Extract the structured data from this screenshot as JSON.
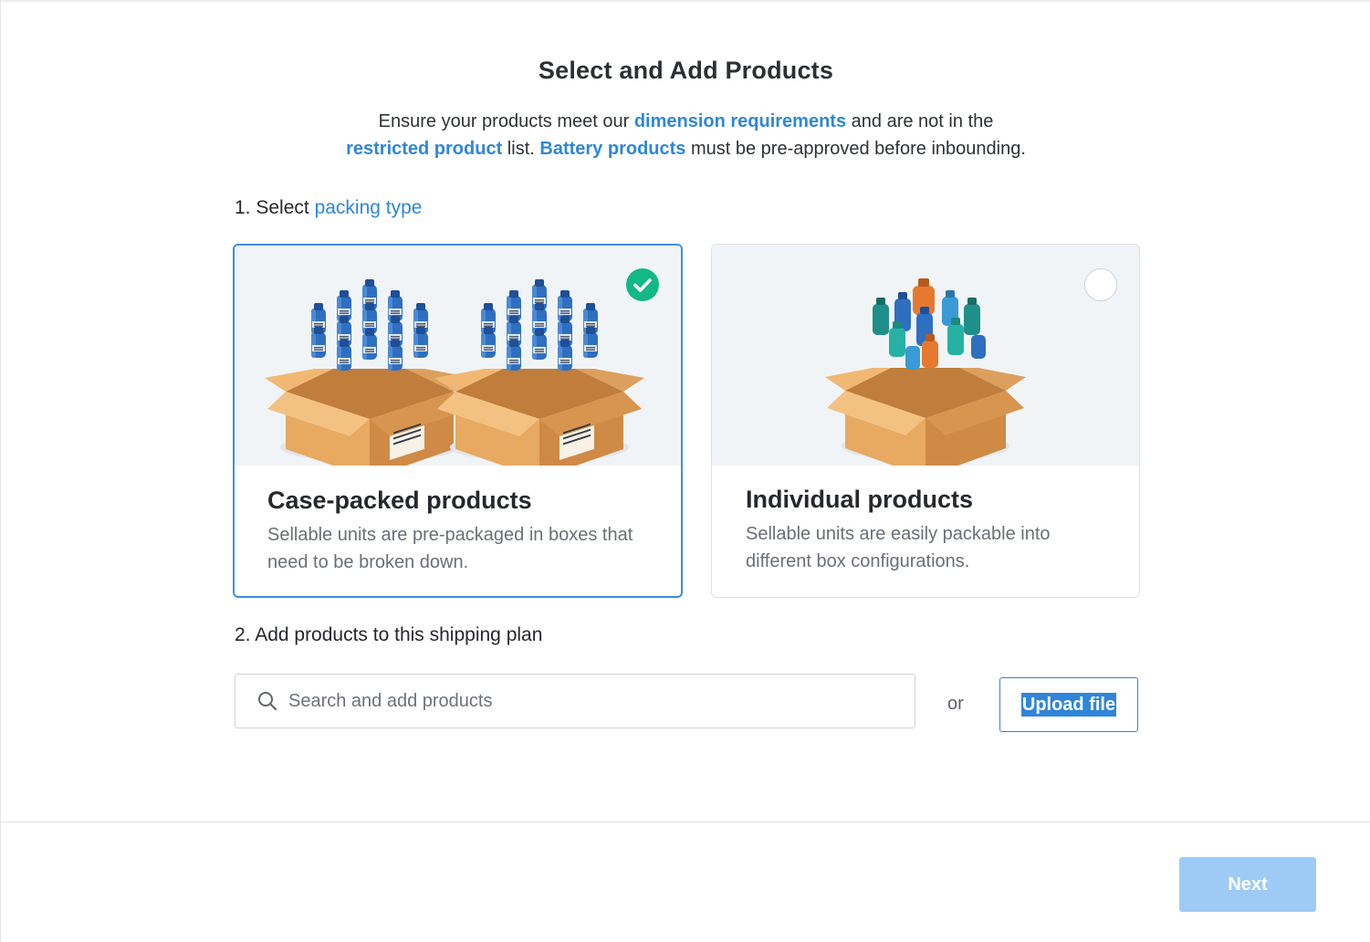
{
  "page": {
    "title": "Select and Add Products"
  },
  "intro": {
    "text1": "Ensure your products meet our ",
    "link1": "dimension requirements",
    "text2": " and are not in the",
    "link2": "restricted product",
    "text3": " list. ",
    "link3": "Battery products",
    "text4": " must be pre-approved before inbounding."
  },
  "step1": {
    "prefix": "1. Select ",
    "link": "packing type"
  },
  "packing_options": [
    {
      "title": "Case-packed products",
      "description": "Sellable units are pre-packaged in boxes that need to be broken down.",
      "selected": true,
      "illustration_icon": "case-packed-boxes-illustration"
    },
    {
      "title": "Individual products",
      "description": "Sellable units are easily packable into different box configurations.",
      "selected": false,
      "illustration_icon": "individual-products-box-illustration"
    }
  ],
  "step2": {
    "label": "2. Add products to this shipping plan"
  },
  "search": {
    "placeholder": "Search and add products",
    "value": "",
    "icon": "search-icon"
  },
  "or_label": "or",
  "upload_label": "Upload file",
  "footer": {
    "next_label": "Next",
    "next_enabled": false
  },
  "colors": {
    "link": "#2f86d8",
    "selected_border": "#3b8fe0",
    "check_green": "#12b886",
    "next_disabled": "#9ecbf5",
    "box_cardboard": "#e6a860",
    "bottle_blue": "#2e6fc0"
  }
}
